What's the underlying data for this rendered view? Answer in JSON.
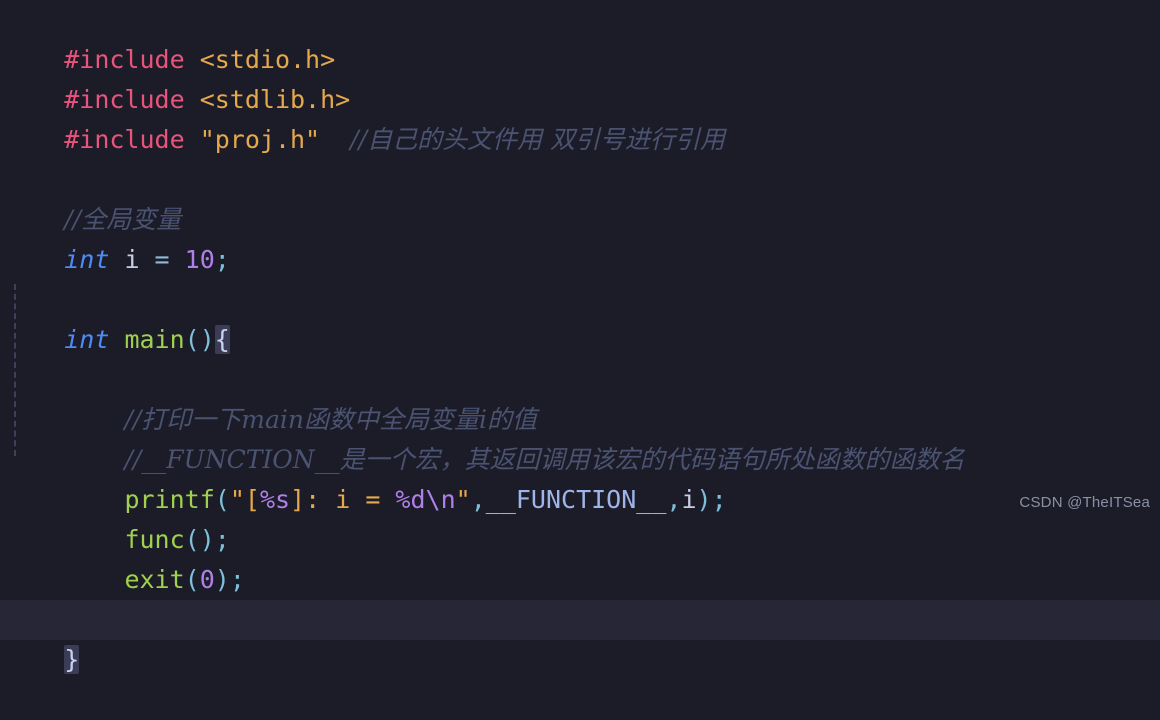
{
  "editor": {
    "background_color": "#1c1c28",
    "current_line_color": "#262636",
    "indent_guide_color": "#3e4059",
    "font_size_px": 25,
    "line_height_px": 40
  },
  "palette": {
    "preprocessor": "#e8547c",
    "header_path": "#e5a84b",
    "string": "#e5a84b",
    "comment": "#4a5372",
    "keyword": "#4d8cf5",
    "function": "#9fd04f",
    "number": "#b07fe8",
    "identifier": "#c8cce0",
    "punctuation": "#7fbfd9",
    "macro": "#9fb4e8",
    "brace_match_bg": "#3a3d55",
    "watermark": "#8a90a6"
  },
  "code": {
    "line1": {
      "directive": "#include",
      "space": " ",
      "header": "<stdio.h>"
    },
    "line2": {
      "directive": "#include",
      "space": " ",
      "header": "<stdlib.h>"
    },
    "line3": {
      "directive": "#include",
      "space": " ",
      "header": "\"proj.h\"",
      "gap": "  ",
      "comment": "//自己的头文件用 双引号进行引用"
    },
    "line5": {
      "comment": "//全局变量"
    },
    "line6": {
      "keyword": "int",
      "space": " ",
      "identifier": "i",
      "operator": " = ",
      "number": "10",
      "semicolon": ";"
    },
    "line8": {
      "keyword": "int",
      "space": " ",
      "function": "main",
      "parens": "()",
      "brace": "{"
    },
    "line10": {
      "indent": "    ",
      "comment": "//打印一下main函数中全局变量i的值"
    },
    "line11": {
      "indent": "    ",
      "comment": "//__FUNCTION__是一个宏，其返回调用该宏的代码语句所处函数的函数名"
    },
    "line12": {
      "indent": "    ",
      "function": "printf",
      "open_paren": "(",
      "quote_open": "\"",
      "str_bracket_open": "[",
      "fmt_s": "%s",
      "str_bracket_close": "]",
      "str_mid": ": i = ",
      "fmt_d": "%d",
      "escape": "\\n",
      "quote_close": "\"",
      "comma1": ",",
      "macro": "__FUNCTION__",
      "comma2": ",",
      "arg": "i",
      "close_paren": ")",
      "semicolon": ";"
    },
    "line13": {
      "indent": "    ",
      "function": "func",
      "parens": "()",
      "semicolon": ";"
    },
    "line14": {
      "indent": "    ",
      "function": "exit",
      "open_paren": "(",
      "number": "0",
      "close_paren": ")",
      "semicolon": ";"
    },
    "line16": {
      "brace": "}"
    }
  },
  "watermark": {
    "text": "CSDN @TheITSea"
  }
}
